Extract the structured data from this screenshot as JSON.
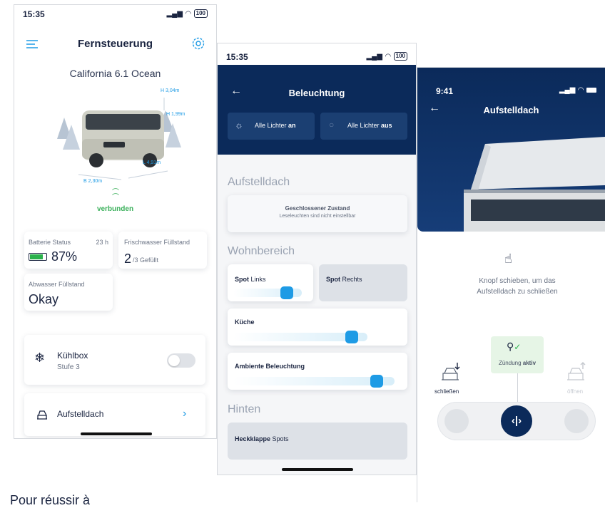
{
  "screen1": {
    "status_time": "15:35",
    "battery": "100",
    "title": "Fernsteuerung",
    "vehicle_name": "California 6.1 Ocean",
    "dims": {
      "h1": "H 3,04m",
      "h2": "H 1,99m",
      "b": "B 2,30m",
      "l": "L 4,91m"
    },
    "connection": "verbunden",
    "battery_card": {
      "label": "Batterie Status",
      "time": "23 h",
      "value": "87%"
    },
    "water_card": {
      "label": "Frischwasser Füllstand",
      "value_main": "2",
      "value_sub": "/3 Gefüllt"
    },
    "waste_card": {
      "label": "Abwasser Füllstand",
      "value": "Okay"
    },
    "fridge": {
      "title": "Kühlbox",
      "sub": "Stufe 3"
    },
    "roof": {
      "title": "Aufstelldach"
    }
  },
  "screen2": {
    "status_time": "15:35",
    "battery": "100",
    "title": "Beleuchtung",
    "all_on_pre": "Alle Lichter ",
    "all_on_bold": "an",
    "all_off_pre": "Alle Lichter ",
    "all_off_bold": "aus",
    "sec_roof": "Aufstelldach",
    "roof_state_title": "Geschlossener Zustand",
    "roof_state_sub": "Leseleuchten sind nicht einstellbar",
    "sec_living": "Wohnbereich",
    "spot_left_bold": "Spot",
    "spot_left_rest": " Links",
    "spot_right_bold": "Spot",
    "spot_right_rest": " Rechts",
    "kitchen": "Küche",
    "ambient": "Ambiente Beleuchtung",
    "sec_rear": "Hinten",
    "tailgate_bold": "Heckklappe",
    "tailgate_rest": " Spots",
    "levels": {
      "spot_left": 0.75,
      "kitchen": 0.75,
      "ambient": 0.8
    }
  },
  "screen3": {
    "status_time": "9:41",
    "title": "Aufstelldach",
    "instruction": "Knopf schieben, um das Aufstelldach zu schließen",
    "ignition_pre": "Zündung ",
    "ignition_bold": "aktiv",
    "close_label": "schließen",
    "open_label": "öffnen"
  },
  "caption": "Pour réussir à"
}
